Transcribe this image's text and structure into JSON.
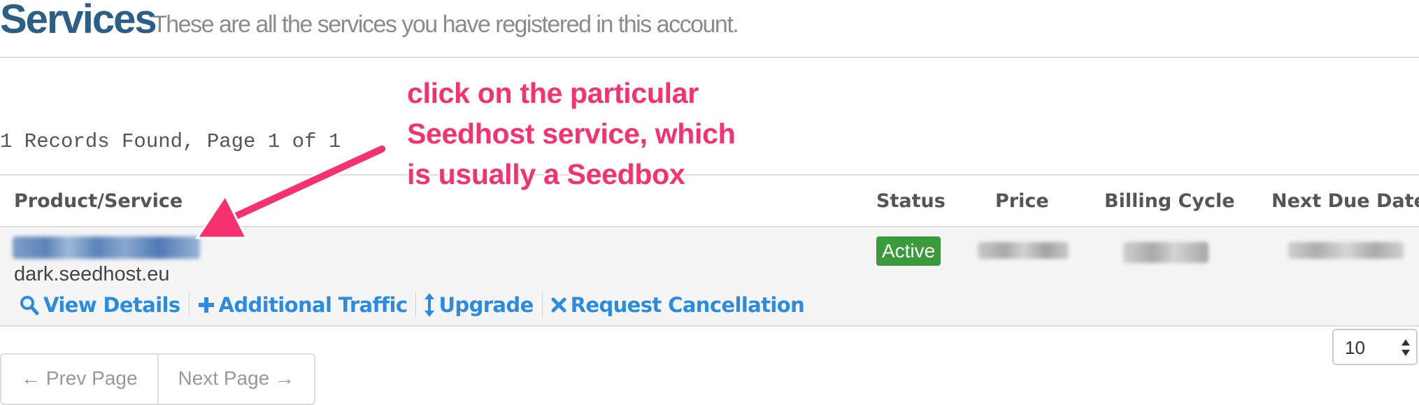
{
  "header": {
    "title": "Services",
    "subtitle": "These are all the services you have registered in this account."
  },
  "records_info": "1 Records Found, Page 1 of 1",
  "table": {
    "columns": [
      "Product/Service",
      "Status",
      "Price",
      "Billing Cycle",
      "Next Due Date"
    ],
    "rows": [
      {
        "domain": "dark.seedhost.eu",
        "status": "Active",
        "actions": [
          {
            "label": "View Details",
            "icon": "search-icon"
          },
          {
            "label": "Additional Traffic",
            "icon": "plus-icon"
          },
          {
            "label": "Upgrade",
            "icon": "vertical-resize-icon"
          },
          {
            "label": "Request Cancellation",
            "icon": "times-icon"
          }
        ]
      }
    ]
  },
  "pagination": {
    "prev": "← Prev Page",
    "next": "Next Page →",
    "page_size": "10"
  },
  "annotation": {
    "lines": [
      "click on the particular",
      "Seedhost service, which",
      "is usually a Seedbox"
    ]
  },
  "colors": {
    "title": "#2c5f86",
    "link": "#2a8be0",
    "status_active": "#3b9a3c",
    "annotation": "#f7306f"
  }
}
